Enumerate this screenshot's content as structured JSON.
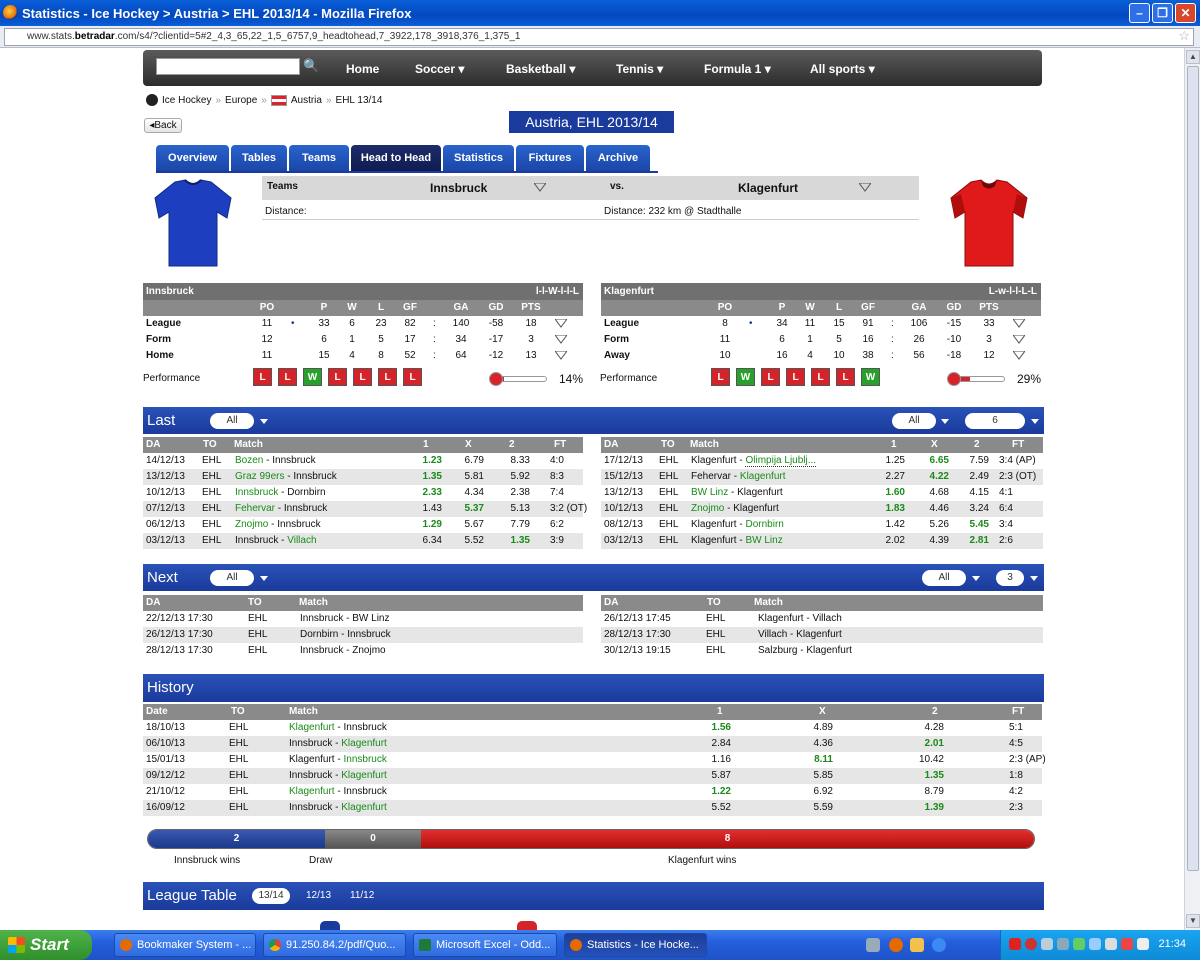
{
  "window": {
    "title": "Statistics - Ice Hockey > Austria > EHL 2013/14 - Mozilla Firefox",
    "url": "www.stats.betradar.com/s4/?clientid=5#2_4,3_65,22_1,5_6757,9_headtohead,7_3922,178_3918,376_1,375_1",
    "url_domain": "betradar"
  },
  "nav": {
    "items": [
      {
        "label": "Home"
      },
      {
        "label": "Soccer"
      },
      {
        "label": "Basketball"
      },
      {
        "label": "Tennis"
      },
      {
        "label": "Formula 1"
      },
      {
        "label": "All sports"
      }
    ]
  },
  "breadcrumb": [
    "Ice Hockey",
    "Europe",
    "Austria",
    "EHL 13/14"
  ],
  "back_label": "Back",
  "page_title": "Austria, EHL 2013/14",
  "tabs": [
    "Overview",
    "Tables",
    "Teams",
    "Head to Head",
    "Statistics",
    "Fixtures",
    "Archive"
  ],
  "active_tab": "Head to Head",
  "teams": {
    "label": "Teams",
    "home": "Innsbruck",
    "vs": "vs.",
    "away": "Klagenfurt",
    "distance_left": "Distance:",
    "distance_right": "Distance: 232 km @ Stadthalle"
  },
  "stats": {
    "cols": [
      "PO",
      "P",
      "W",
      "L",
      "GF",
      "GA",
      "GD",
      "PTS"
    ],
    "home": {
      "team": "Innsbruck",
      "form": "l-l-W-l-l-L",
      "rows": [
        {
          "label": "League",
          "po": "11",
          "p": "33",
          "w": "6",
          "l": "23",
          "gf": "82",
          "ga": "140",
          "gd": "-58",
          "pts": "18"
        },
        {
          "label": "Form",
          "po": "12",
          "p": "6",
          "w": "1",
          "l": "5",
          "gf": "17",
          "ga": "34",
          "gd": "-17",
          "pts": "3"
        },
        {
          "label": "Home",
          "po": "11",
          "p": "15",
          "w": "4",
          "l": "8",
          "gf": "52",
          "ga": "64",
          "gd": "-12",
          "pts": "13"
        }
      ],
      "performance": [
        "L",
        "L",
        "W",
        "L",
        "L",
        "L",
        "L"
      ],
      "percent": "14%",
      "percent_value": 14
    },
    "away": {
      "team": "Klagenfurt",
      "form": "L-w-l-l-L-L",
      "rows": [
        {
          "label": "League",
          "po": "8",
          "p": "34",
          "w": "11",
          "l": "15",
          "gf": "91",
          "ga": "106",
          "gd": "-15",
          "pts": "33"
        },
        {
          "label": "Form",
          "po": "11",
          "p": "6",
          "w": "1",
          "l": "5",
          "gf": "16",
          "ga": "26",
          "gd": "-10",
          "pts": "3"
        },
        {
          "label": "Away",
          "po": "10",
          "p": "16",
          "w": "4",
          "l": "10",
          "gf": "38",
          "ga": "56",
          "gd": "-18",
          "pts": "12"
        }
      ],
      "performance": [
        "L",
        "W",
        "L",
        "L",
        "L",
        "L",
        "W"
      ],
      "percent": "29%",
      "percent_value": 29
    },
    "perf_label": "Performance",
    "colon": ":"
  },
  "last": {
    "title": "Last",
    "filter": "All",
    "filter_right": "All",
    "count": "6",
    "cols": [
      "DA",
      "TO",
      "Match",
      "1",
      "X",
      "2",
      "FT"
    ],
    "home": [
      {
        "da": "14/12/13",
        "to": "EHL",
        "a": "Bozen",
        "b": "Innsbruck",
        "hl": "a",
        "o1": "1.23",
        "ox": "6.79",
        "o2": "8.33",
        "ft": "4:0",
        "win": "1"
      },
      {
        "da": "13/12/13",
        "to": "EHL",
        "a": "Graz 99ers",
        "b": "Innsbruck",
        "hl": "a",
        "o1": "1.35",
        "ox": "5.81",
        "o2": "5.92",
        "ft": "8:3",
        "win": "1"
      },
      {
        "da": "10/12/13",
        "to": "EHL",
        "a": "Innsbruck",
        "b": "Dornbirn",
        "hl": "a",
        "o1": "2.33",
        "ox": "4.34",
        "o2": "2.38",
        "ft": "7:4",
        "win": "1"
      },
      {
        "da": "07/12/13",
        "to": "EHL",
        "a": "Fehervar",
        "b": "Innsbruck",
        "hl": "a",
        "o1": "1.43",
        "ox": "5.37",
        "o2": "5.13",
        "ft": "3:2 (OT)",
        "win": "x"
      },
      {
        "da": "06/12/13",
        "to": "EHL",
        "a": "Znojmo",
        "b": "Innsbruck",
        "hl": "a",
        "o1": "1.29",
        "ox": "5.67",
        "o2": "7.79",
        "ft": "6:2",
        "win": "1"
      },
      {
        "da": "03/12/13",
        "to": "EHL",
        "a": "Innsbruck",
        "b": "Villach",
        "hl": "b",
        "o1": "6.34",
        "ox": "5.52",
        "o2": "1.35",
        "ft": "3:9",
        "win": "2"
      }
    ],
    "away": [
      {
        "da": "17/12/13",
        "to": "EHL",
        "a": "Klagenfurt",
        "b": "Olimpija Ljublj...",
        "hl": "b",
        "o1": "1.25",
        "ox": "6.65",
        "o2": "7.59",
        "ft": "3:4 (AP)",
        "win": "x"
      },
      {
        "da": "15/12/13",
        "to": "EHL",
        "a": "Fehervar",
        "b": "Klagenfurt",
        "hl": "b",
        "o1": "2.27",
        "ox": "4.22",
        "o2": "2.49",
        "ft": "2:3 (OT)",
        "win": "x"
      },
      {
        "da": "13/12/13",
        "to": "EHL",
        "a": "BW Linz",
        "b": "Klagenfurt",
        "hl": "a",
        "o1": "1.60",
        "ox": "4.68",
        "o2": "4.15",
        "ft": "4:1",
        "win": "1"
      },
      {
        "da": "10/12/13",
        "to": "EHL",
        "a": "Znojmo",
        "b": "Klagenfurt",
        "hl": "a",
        "o1": "1.83",
        "ox": "4.46",
        "o2": "3.24",
        "ft": "6:4",
        "win": "1"
      },
      {
        "da": "08/12/13",
        "to": "EHL",
        "a": "Klagenfurt",
        "b": "Dornbirn",
        "hl": "b",
        "o1": "1.42",
        "ox": "5.26",
        "o2": "5.45",
        "ft": "3:4",
        "win": "2"
      },
      {
        "da": "03/12/13",
        "to": "EHL",
        "a": "Klagenfurt",
        "b": "BW Linz",
        "hl": "b",
        "o1": "2.02",
        "ox": "4.39",
        "o2": "2.81",
        "ft": "2:6",
        "win": "2"
      }
    ]
  },
  "next": {
    "title": "Next",
    "filter": "All",
    "filter_right": "All",
    "count": "3",
    "cols": [
      "DA",
      "TO",
      "Match"
    ],
    "home": [
      {
        "da": "22/12/13 17:30",
        "to": "EHL",
        "m": "Innsbruck - BW Linz"
      },
      {
        "da": "26/12/13 17:30",
        "to": "EHL",
        "m": "Dornbirn - Innsbruck"
      },
      {
        "da": "28/12/13 17:30",
        "to": "EHL",
        "m": "Innsbruck - Znojmo"
      }
    ],
    "away": [
      {
        "da": "26/12/13 17:45",
        "to": "EHL",
        "m": "Klagenfurt - Villach"
      },
      {
        "da": "28/12/13 17:30",
        "to": "EHL",
        "m": "Villach - Klagenfurt"
      },
      {
        "da": "30/12/13 19:15",
        "to": "EHL",
        "m": "Salzburg - Klagenfurt"
      }
    ]
  },
  "history": {
    "title": "History",
    "cols": [
      "Date",
      "TO",
      "Match",
      "1",
      "X",
      "2",
      "FT"
    ],
    "rows": [
      {
        "da": "18/10/13",
        "to": "EHL",
        "a": "Klagenfurt",
        "b": "Innsbruck",
        "hl": "a",
        "o1": "1.56",
        "ox": "4.89",
        "o2": "4.28",
        "ft": "5:1",
        "win": "1"
      },
      {
        "da": "06/10/13",
        "to": "EHL",
        "a": "Innsbruck",
        "b": "Klagenfurt",
        "hl": "b",
        "o1": "2.84",
        "ox": "4.36",
        "o2": "2.01",
        "ft": "4:5",
        "win": "2"
      },
      {
        "da": "15/01/13",
        "to": "EHL",
        "a": "Klagenfurt",
        "b": "Innsbruck",
        "hl": "b",
        "o1": "1.16",
        "ox": "8.11",
        "o2": "10.42",
        "ft": "2:3 (AP)",
        "win": "x"
      },
      {
        "da": "09/12/12",
        "to": "EHL",
        "a": "Innsbruck",
        "b": "Klagenfurt",
        "hl": "b",
        "o1": "5.87",
        "ox": "5.85",
        "o2": "1.35",
        "ft": "1:8",
        "win": "2"
      },
      {
        "da": "21/10/12",
        "to": "EHL",
        "a": "Klagenfurt",
        "b": "Innsbruck",
        "hl": "a",
        "o1": "1.22",
        "ox": "6.92",
        "o2": "8.79",
        "ft": "4:2",
        "win": "1"
      },
      {
        "da": "16/09/12",
        "to": "EHL",
        "a": "Innsbruck",
        "b": "Klagenfurt",
        "hl": "b",
        "o1": "5.52",
        "ox": "5.59",
        "o2": "1.39",
        "ft": "2:3",
        "win": "2"
      }
    ],
    "bar": {
      "home": "2",
      "draw": "0",
      "away": "8",
      "home_label": "Innsbruck wins",
      "draw_label": "Draw",
      "away_label": "Klagenfurt wins",
      "home_value": 2,
      "draw_value": 0,
      "away_value": 8
    }
  },
  "league": {
    "title": "League Table",
    "seasons": [
      "13/14",
      "12/13",
      "11/12"
    ]
  },
  "taskbar": {
    "start": "Start",
    "tasks": [
      "Bookmaker System - ...",
      "91.250.84.2/pdf/Quo...",
      "Microsoft Excel - Odd...",
      "Statistics - Ice Hocke..."
    ],
    "clock": "21:34"
  },
  "colors": {
    "brand_blue": "#1a3a9c",
    "loss_red": "#d4242a",
    "win_green": "#2aa02c"
  }
}
